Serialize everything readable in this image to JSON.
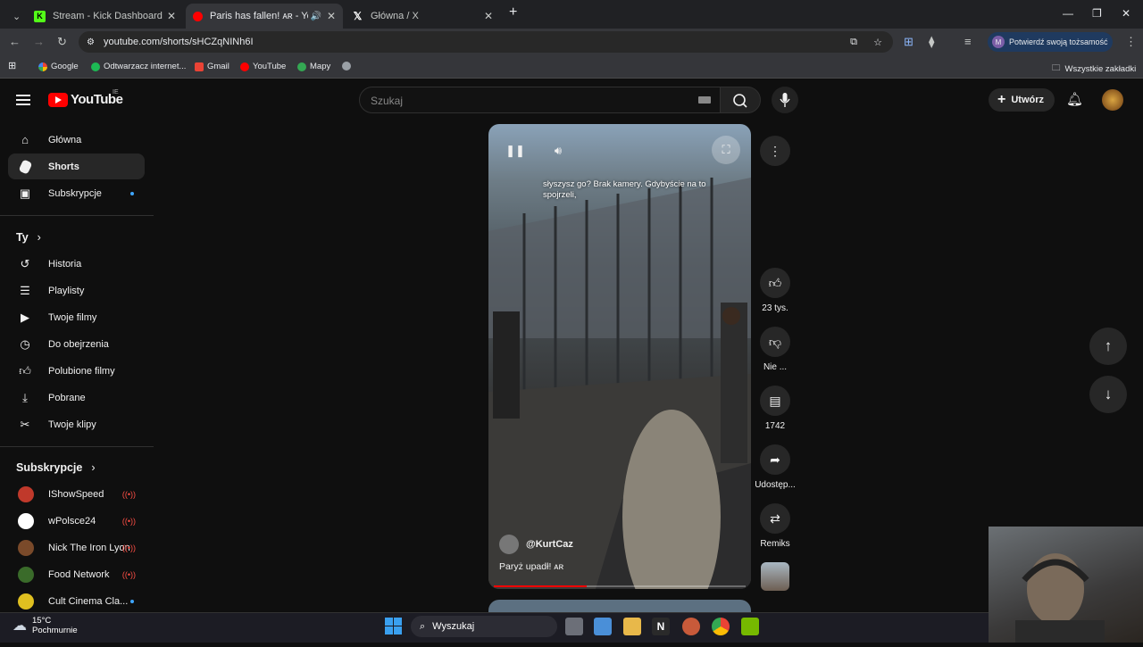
{
  "browser": {
    "tabs": [
      {
        "title": "Stream - Kick Dashboard",
        "icon": "kick-icon"
      },
      {
        "title": "Paris has fallen! ᴀʀ - YouTube",
        "icon": "youtube-icon"
      },
      {
        "title": "Główna / X",
        "icon": "x-icon"
      }
    ],
    "url": "youtube.com/shorts/sHCZqNINh6I",
    "profile_label": "Potwierdź swoją tożsamość",
    "profile_initial": "M",
    "bookmarks": [
      "Google",
      "Odtwarzacz internet...",
      "Gmail",
      "YouTube",
      "Mapy"
    ],
    "all_bookmarks": "Wszystkie zakładki"
  },
  "youtube": {
    "logo": "YouTube",
    "country": "IE",
    "search_placeholder": "Szukaj",
    "create_label": "Utwórz",
    "sidebar": {
      "main": [
        {
          "label": "Główna",
          "icon": "home-icon"
        },
        {
          "label": "Shorts",
          "icon": "shorts-icon",
          "selected": true
        },
        {
          "label": "Subskrypcje",
          "icon": "subscriptions-icon"
        }
      ],
      "you_header": "Ty",
      "you": [
        {
          "label": "Historia",
          "icon": "history-icon"
        },
        {
          "label": "Playlisty",
          "icon": "playlist-icon"
        },
        {
          "label": "Twoje filmy",
          "icon": "your-videos-icon"
        },
        {
          "label": "Do obejrzenia",
          "icon": "watch-later-icon"
        },
        {
          "label": "Polubione filmy",
          "icon": "liked-icon"
        },
        {
          "label": "Pobrane",
          "icon": "download-icon"
        },
        {
          "label": "Twoje klipy",
          "icon": "clips-icon"
        }
      ],
      "subs_header": "Subskrypcje",
      "subscriptions": [
        {
          "label": "IShowSpeed",
          "status": "live",
          "color": "#c0392b"
        },
        {
          "label": "wPolsce24",
          "status": "live",
          "color": "#ffffff"
        },
        {
          "label": "Nick The Iron Lyon",
          "status": "live",
          "color": "#7a4a2a"
        },
        {
          "label": "Food Network",
          "status": "live",
          "color": "#3a6b2a"
        },
        {
          "label": "Cult Cinema Cla...",
          "status": "new",
          "color": "#e0c020"
        }
      ]
    },
    "short": {
      "caption": "słyszysz go?  Brak kamery.  Gdybyście na to spojrzeli,",
      "channel": "@KurtCaz",
      "title": "Paryż upadł! ᴀʀ",
      "progress": 0.37
    },
    "actions": {
      "likes": "23 tys.",
      "dislike": "Nie ...",
      "comments": "1742",
      "share": "Udostęp...",
      "remix": "Remiks"
    }
  },
  "taskbar": {
    "temp": "15°C",
    "weather": "Pochmurnie",
    "search": "Wyszukaj"
  }
}
